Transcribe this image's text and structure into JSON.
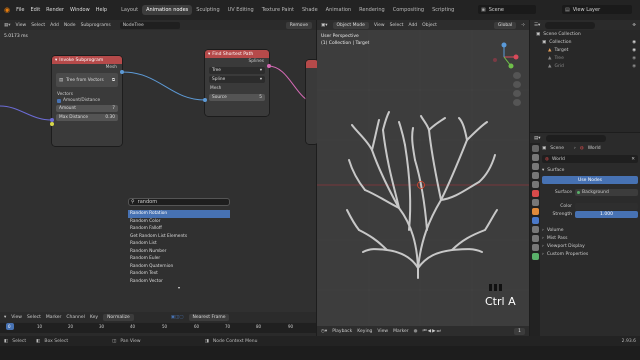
{
  "topbar": {
    "menus": [
      "File",
      "Edit",
      "Render",
      "Window",
      "Help"
    ],
    "workspaces": [
      "Layout",
      "Animation nodes",
      "Sculpting",
      "UV Editing",
      "Texture Paint",
      "Shade",
      "Animation",
      "Rendering",
      "Compositing",
      "Scripting"
    ],
    "active_workspace_index": 1,
    "scene_label": "Scene",
    "view_layer_label": "View Layer"
  },
  "node_editor": {
    "header": [
      "View",
      "Select",
      "Add",
      "Node",
      "Subprograms"
    ],
    "tree_name": "NodeTree",
    "remove_label": "Remove",
    "timing": "5.0173 ms",
    "node_subprogram": {
      "title": "Invoke Subprogram",
      "out_mesh": "Mesh",
      "tree_from_vectors": "Tree from Vectors",
      "vectors_label": "Vectors",
      "amount_distance": "Amount/Distance",
      "amount_label": "Amount",
      "amount_value": "7",
      "max_distance_label": "Max Distance",
      "max_distance_value": "0.30"
    },
    "node_shortest_path": {
      "title": "Find Shortest Path",
      "out_splines": "Splines",
      "opt_tree": "Tree",
      "opt_spline": "Spline",
      "in_mesh": "Mesh",
      "source_label": "Source",
      "source_value": "5"
    },
    "search": {
      "query": "random",
      "results": [
        "Random Rotation",
        "Random Color",
        "Random Falloff",
        "Get Random List Elements",
        "Random List",
        "Random Number",
        "Random Euler",
        "Random Quaternion",
        "Random Text",
        "Random Vector"
      ],
      "highlighted_index": 0
    }
  },
  "timeline": {
    "header": [
      "View",
      "Select",
      "Marker",
      "Channel",
      "Key"
    ],
    "mode": "Normalize",
    "frame_mode": "Nearest Frame",
    "ticks": [
      "0",
      "10",
      "20",
      "30",
      "40",
      "50",
      "60",
      "70",
      "80",
      "90"
    ]
  },
  "viewport": {
    "mode": "Object Mode",
    "menus": [
      "View",
      "Select",
      "Add",
      "Object"
    ],
    "orientation": "Global",
    "perspective": "User Perspective",
    "collection_target": "(1) Collection | Target",
    "shortcut_overlay": "Ctrl A",
    "footer": [
      "Playback",
      "Keying",
      "View",
      "Marker"
    ],
    "current_frame": "1"
  },
  "outliner": {
    "title": "Scene Collection",
    "items": [
      "Collection",
      "Target",
      "Tree",
      "Grid"
    ]
  },
  "properties": {
    "scene": "Scene",
    "world_tab": "World",
    "world_name": "World",
    "surface_section": "Surface",
    "use_nodes": "Use Nodes",
    "surface_label": "Surface",
    "surface_value": "Background",
    "color_label": "Color",
    "strength_label": "Strength",
    "strength_value": "1.000",
    "sections": [
      "Volume",
      "Mist Pass",
      "Viewport Display",
      "Custom Properties"
    ]
  },
  "statusbar": {
    "select": "Select",
    "box_select": "Box Select",
    "pan_view": "Pan View",
    "context_menu": "Node Context Menu",
    "version": "2.93.6"
  },
  "colors": {
    "accent": "#4772b3",
    "subprogram_header": "#b54a4a",
    "shortest_path_header": "#b54a4a",
    "socket_mesh": "#5d9ad6",
    "socket_spline": "#d56ab5",
    "socket_vector": "#6c6cd6",
    "socket_bool": "#d6d64a",
    "tree_branches": "#c8c8c8",
    "axis_x": "#b4343c"
  },
  "icons": [
    "blender-logo-icon",
    "editor-type-icon",
    "search-icon",
    "camera-icon",
    "eye-icon",
    "world-icon",
    "play-icon"
  ]
}
